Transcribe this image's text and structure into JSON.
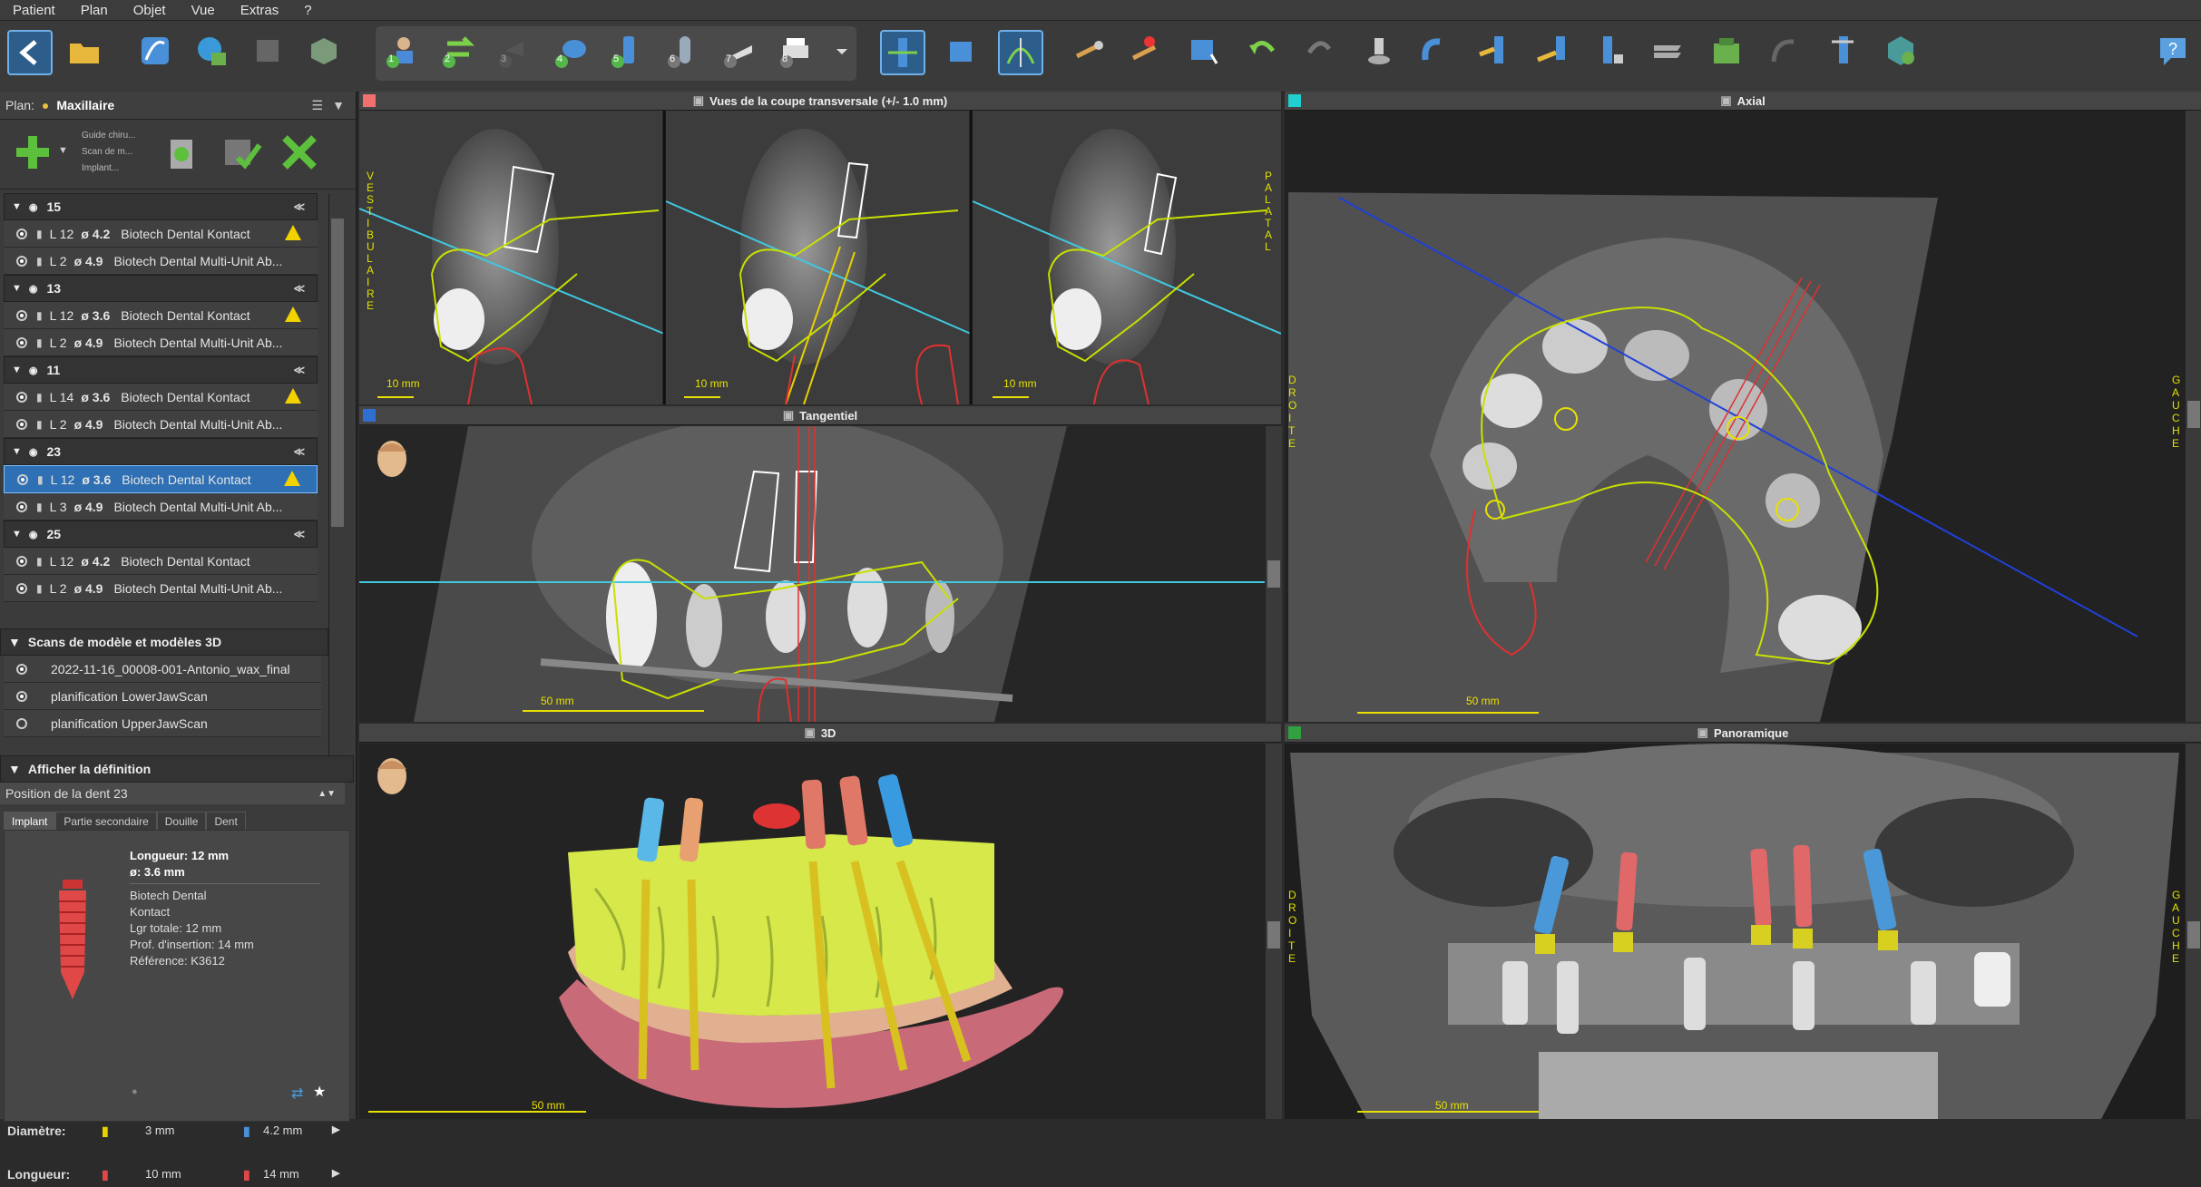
{
  "menu": [
    "Patient",
    "Plan",
    "Objet",
    "Vue",
    "Extras",
    "?"
  ],
  "toolbar_numbers": [
    "1",
    "2",
    "3",
    "4",
    "5",
    "6",
    "7",
    "8"
  ],
  "plan": {
    "label": "Plan:",
    "name": "Maxillaire"
  },
  "actions": {
    "guide": "Guide chiru...",
    "scan": "Scan de m...",
    "implant": "Implant..."
  },
  "implants": [
    {
      "tooth": "15",
      "rows": [
        {
          "l": "L 12",
          "d": "ø 4.2",
          "name": "Biotech Dental Kontact",
          "warn": true
        },
        {
          "l": "L 2",
          "d": "ø 4.9",
          "name": "Biotech Dental Multi-Unit Ab...",
          "warn": false
        }
      ]
    },
    {
      "tooth": "13",
      "rows": [
        {
          "l": "L 12",
          "d": "ø 3.6",
          "name": "Biotech Dental Kontact",
          "warn": true
        },
        {
          "l": "L 2",
          "d": "ø 4.9",
          "name": "Biotech Dental Multi-Unit Ab...",
          "warn": false
        }
      ]
    },
    {
      "tooth": "11",
      "rows": [
        {
          "l": "L 14",
          "d": "ø 3.6",
          "name": "Biotech Dental Kontact",
          "warn": true
        },
        {
          "l": "L 2",
          "d": "ø 4.9",
          "name": "Biotech Dental Multi-Unit Ab...",
          "warn": false
        }
      ]
    },
    {
      "tooth": "23",
      "rows": [
        {
          "l": "L 12",
          "d": "ø 3.6",
          "name": "Biotech Dental Kontact",
          "warn": true,
          "selected": true
        },
        {
          "l": "L 3",
          "d": "ø 4.9",
          "name": "Biotech Dental Multi-Unit Ab...",
          "warn": false
        }
      ]
    },
    {
      "tooth": "25",
      "rows": [
        {
          "l": "L 12",
          "d": "ø 4.2",
          "name": "Biotech Dental Kontact",
          "warn": false
        },
        {
          "l": "L 2",
          "d": "ø 4.9",
          "name": "Biotech Dental Multi-Unit Ab...",
          "warn": false
        }
      ]
    }
  ],
  "scans": {
    "header": "Scans de modèle et modèles 3D",
    "items": [
      "2022-11-16_00008-001-Antonio_wax_final",
      "planification LowerJawScan",
      "planification UpperJawScan"
    ]
  },
  "definition": {
    "header": "Afficher la définition",
    "position": "Position de la dent 23"
  },
  "tabs": [
    "Implant",
    "Partie secondaire",
    "Douille",
    "Dent"
  ],
  "implant_info": {
    "length": "Longueur: 12 mm",
    "diameter": "ø: 3.6 mm",
    "brand": "Biotech Dental",
    "model": "Kontact",
    "total": "Lgr totale: 12 mm",
    "insertion": "Prof. d'insertion: 14 mm",
    "ref": "Référence: K3612"
  },
  "diam": {
    "label": "Diamètre:",
    "a": "3 mm",
    "b": "4.2 mm"
  },
  "len": {
    "label": "Longueur:",
    "a": "10 mm",
    "b": "14 mm"
  },
  "views": {
    "cross": "Vues de la coupe transversale (+/- 1.0 mm)",
    "axial": "Axial",
    "tangential": "Tangentiel",
    "v3d": "3D",
    "pano": "Panoramique"
  },
  "labels": {
    "vest": "VESTIBULAIRE",
    "pal": "PALATAL",
    "droite": "DROITE",
    "gauche": "GAUCHE"
  },
  "scales": {
    "s10": "10 mm",
    "s50": "50 mm"
  },
  "colors": {
    "accent": "#2f6fb3",
    "warning": "#f2d300",
    "guide_line": "#c8e000"
  }
}
